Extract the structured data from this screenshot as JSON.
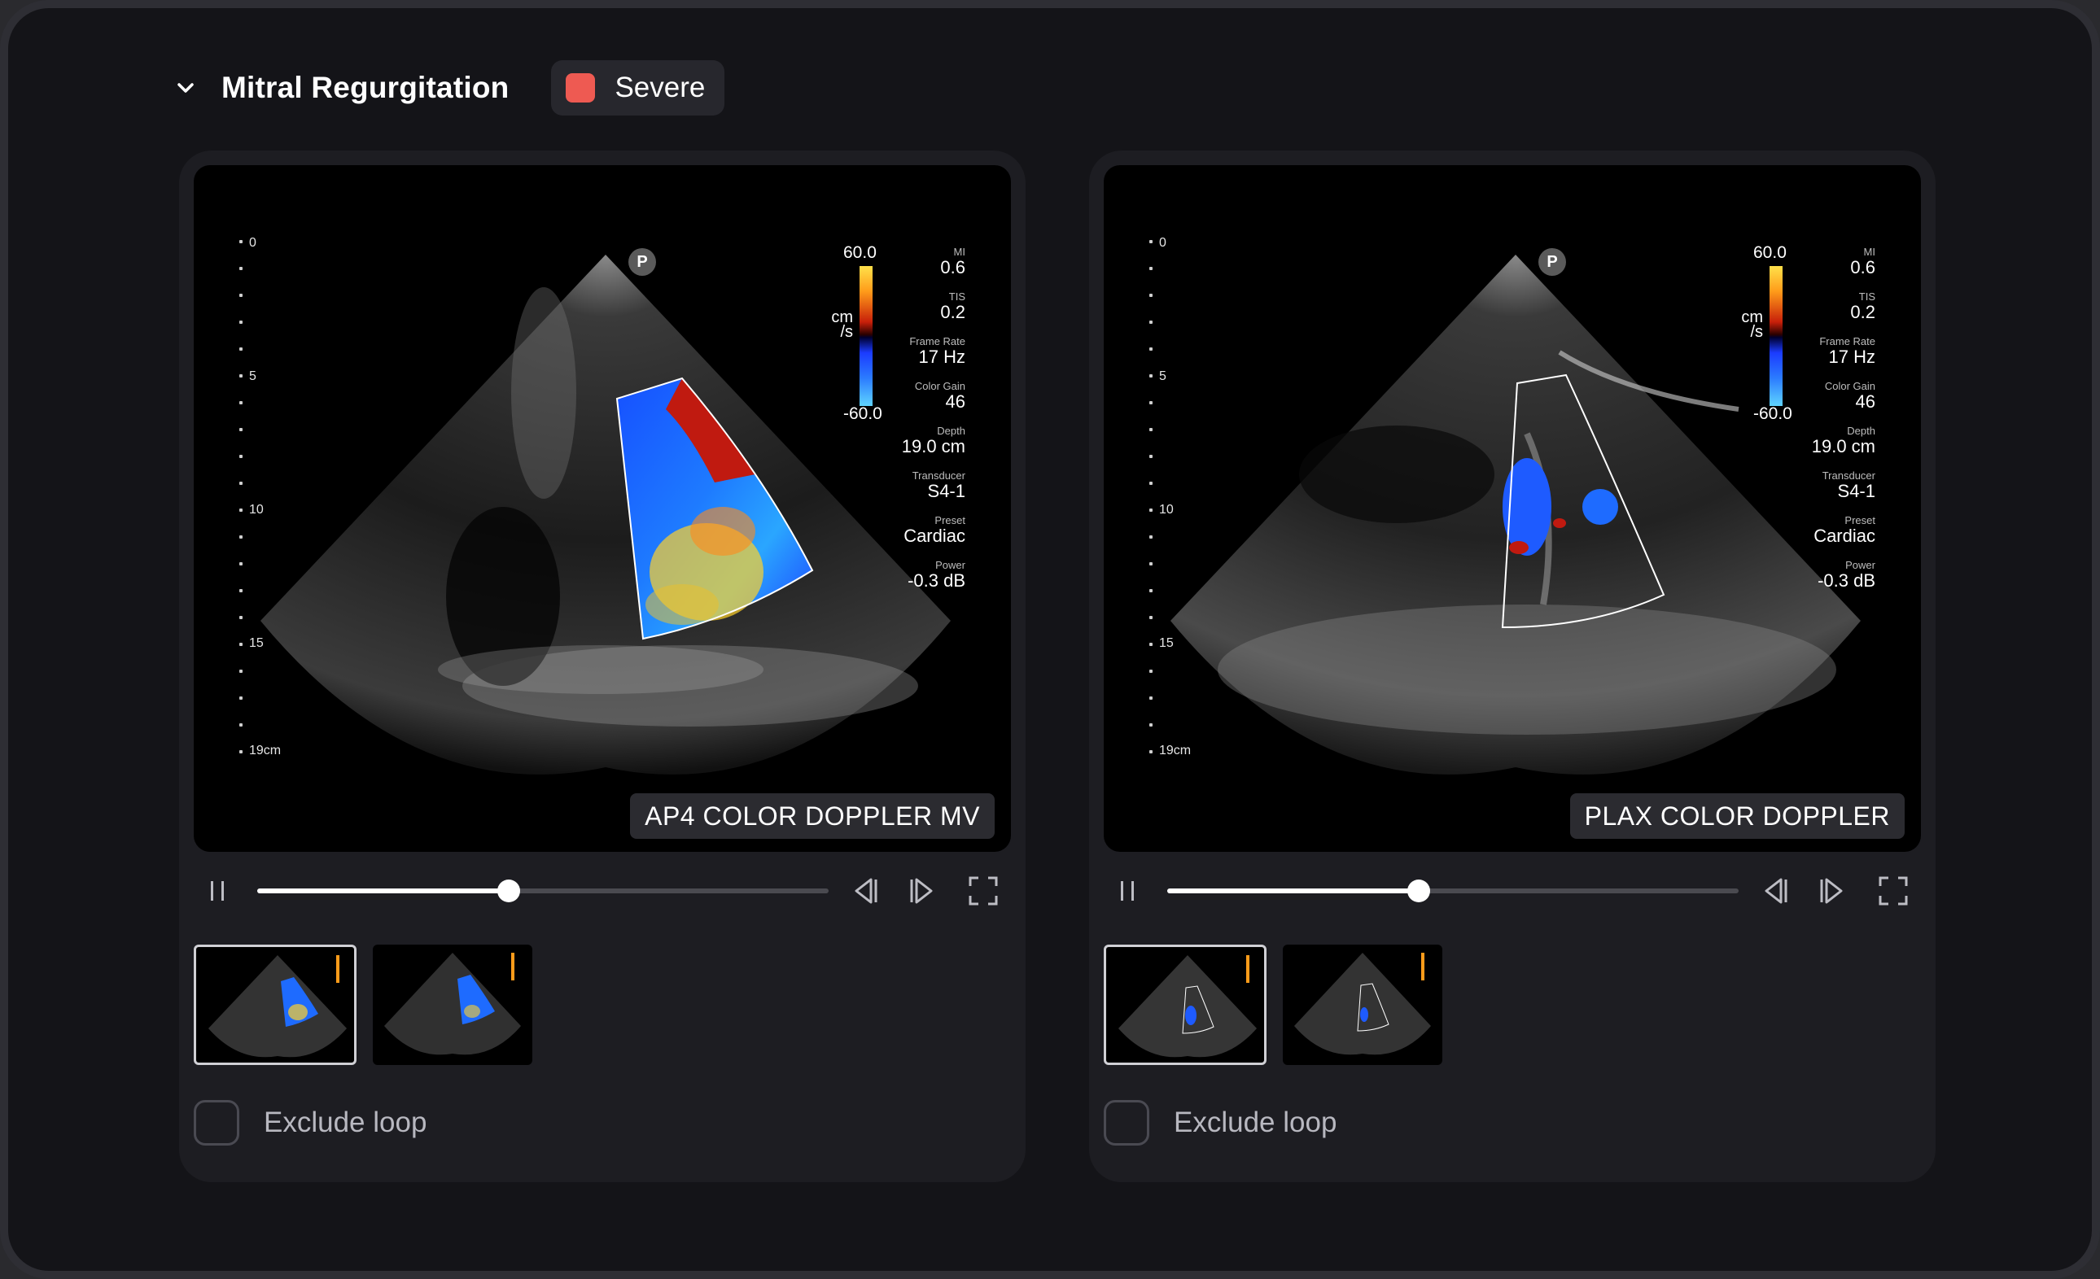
{
  "header": {
    "title": "Mitral Regurgitation",
    "severity": {
      "label": "Severe",
      "color": "#ee5a52"
    }
  },
  "cards": [
    {
      "view_label": "AP4 COLOR DOPPLER MV",
      "probe_marker": "P",
      "depth_labels": [
        "0",
        "5",
        "10",
        "15",
        "19cm"
      ],
      "colorbar": {
        "max": "60.0",
        "min": "-60.0",
        "unit_top": "cm",
        "unit_bottom": "/s"
      },
      "params": [
        {
          "name": "MI",
          "value": "0.6"
        },
        {
          "name": "TIS",
          "value": "0.2"
        },
        {
          "name": "Frame Rate",
          "value": "17 Hz"
        },
        {
          "name": "Color Gain",
          "value": "46"
        },
        {
          "name": "Depth",
          "value": "19.0 cm"
        },
        {
          "name": "Transducer",
          "value": "S4-1"
        },
        {
          "name": "Preset",
          "value": "Cardiac"
        },
        {
          "name": "Power",
          "value": "-0.3 dB"
        }
      ],
      "playback_progress": 0.44,
      "exclude_label": "Exclude loop",
      "exclude_checked": false
    },
    {
      "view_label": "PLAX COLOR DOPPLER",
      "probe_marker": "P",
      "depth_labels": [
        "0",
        "5",
        "10",
        "15",
        "19cm"
      ],
      "colorbar": {
        "max": "60.0",
        "min": "-60.0",
        "unit_top": "cm",
        "unit_bottom": "/s"
      },
      "params": [
        {
          "name": "MI",
          "value": "0.6"
        },
        {
          "name": "TIS",
          "value": "0.2"
        },
        {
          "name": "Frame Rate",
          "value": "17 Hz"
        },
        {
          "name": "Color Gain",
          "value": "46"
        },
        {
          "name": "Depth",
          "value": "19.0 cm"
        },
        {
          "name": "Transducer",
          "value": "S4-1"
        },
        {
          "name": "Preset",
          "value": "Cardiac"
        },
        {
          "name": "Power",
          "value": "-0.3 dB"
        }
      ],
      "playback_progress": 0.44,
      "exclude_label": "Exclude loop",
      "exclude_checked": false
    }
  ],
  "icons": {
    "collapse": "chevron-down-icon",
    "pause": "pause-icon",
    "prev_frame": "step-back-icon",
    "next_frame": "step-forward-icon",
    "fullscreen": "fullscreen-icon"
  }
}
